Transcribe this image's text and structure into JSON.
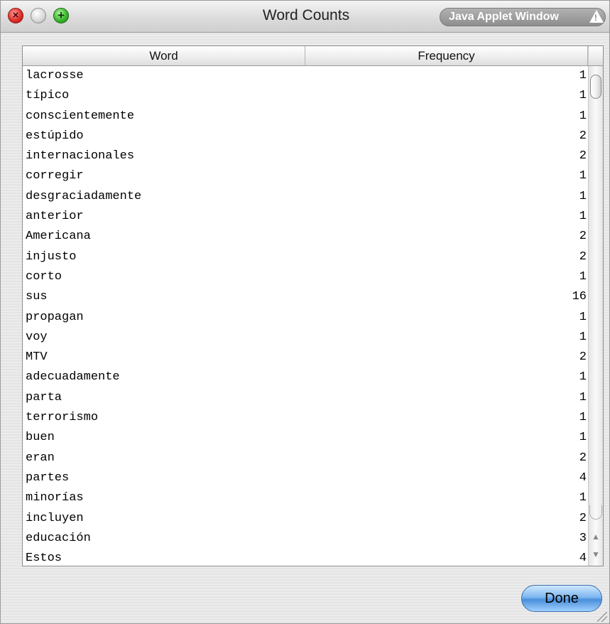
{
  "window": {
    "title": "Word Counts",
    "applet_badge": "Java Applet Window",
    "controls": [
      "close",
      "minimize",
      "zoom"
    ]
  },
  "table": {
    "columns": [
      "Word",
      "Frequency"
    ],
    "rows": [
      {
        "word": "lacrosse",
        "frequency": "1"
      },
      {
        "word": "típico",
        "frequency": "1"
      },
      {
        "word": "conscientemente",
        "frequency": "1"
      },
      {
        "word": "estúpido",
        "frequency": "2"
      },
      {
        "word": "internacionales",
        "frequency": "2"
      },
      {
        "word": "corregir",
        "frequency": "1"
      },
      {
        "word": "desgraciadamente",
        "frequency": "1"
      },
      {
        "word": "anterior",
        "frequency": "1"
      },
      {
        "word": "Americana",
        "frequency": "2"
      },
      {
        "word": "injusto",
        "frequency": "2"
      },
      {
        "word": "corto",
        "frequency": "1"
      },
      {
        "word": "sus",
        "frequency": "16"
      },
      {
        "word": "propagan",
        "frequency": "1"
      },
      {
        "word": "voy",
        "frequency": "1"
      },
      {
        "word": "MTV",
        "frequency": "2"
      },
      {
        "word": "adecuadamente",
        "frequency": "1"
      },
      {
        "word": "parta",
        "frequency": "1"
      },
      {
        "word": "terrorismo",
        "frequency": "1"
      },
      {
        "word": "buen",
        "frequency": "1"
      },
      {
        "word": "eran",
        "frequency": "2"
      },
      {
        "word": "partes",
        "frequency": "4"
      },
      {
        "word": "minorías",
        "frequency": "1"
      },
      {
        "word": "incluyen",
        "frequency": "2"
      },
      {
        "word": "educación",
        "frequency": "3"
      },
      {
        "word": "Estos",
        "frequency": "4"
      }
    ]
  },
  "footer": {
    "done_label": "Done"
  },
  "colors": {
    "accent": "#4a8fdb",
    "close": "#e0302a",
    "zoom": "#39b82b"
  }
}
